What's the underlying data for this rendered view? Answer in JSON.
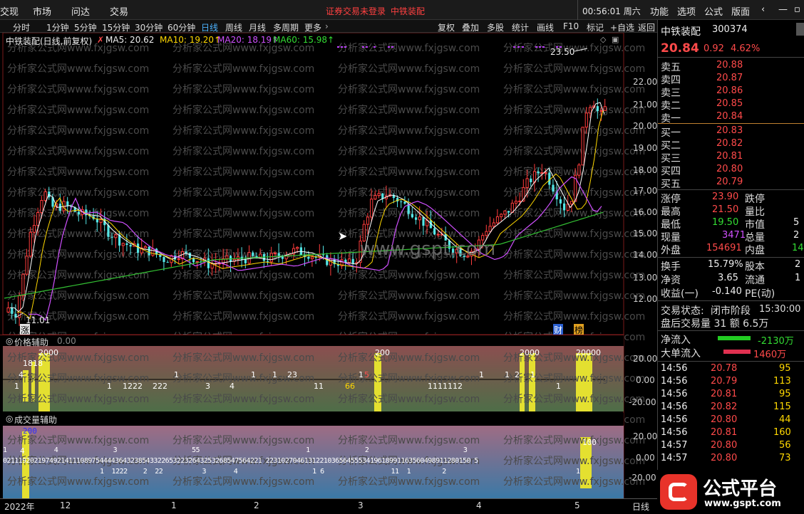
{
  "topbar": {
    "menu": [
      "交现",
      "市场",
      "问达",
      "交易"
    ],
    "warn_text": "证券交易未登录",
    "stock_short": "中铁装配",
    "time": "00:56:01 周六",
    "right_menu": [
      "功能",
      "选项",
      "公式",
      "版面"
    ]
  },
  "periods": {
    "items": [
      "分时",
      "1分钟",
      "5分钟",
      "15分钟",
      "30分钟",
      "60分钟",
      "日线",
      "周线",
      "月线",
      "多周期",
      "更多"
    ],
    "active": "日线",
    "tools": [
      "复权",
      "叠加",
      "多股",
      "统计",
      "画线",
      "F10",
      "标记",
      "+自选",
      "返回"
    ]
  },
  "legend": {
    "name": "中铁装配(日线,前复权)",
    "ma5": "MA5: 20.62",
    "ma10": "MA10: 19.20↑",
    "ma20": "MA20: 18.19↑",
    "ma60": "MA60: 15.98↑"
  },
  "main_axis": {
    "labels": [
      "22.00",
      "21.00",
      "20.00",
      "19.00",
      "18.00",
      "17.00",
      "16.00",
      "15.00",
      "14.00",
      "13.00",
      "12.00"
    ],
    "high_mark": "23.50",
    "low_mark": "11.01",
    "tag_zhang": "涨",
    "tag_cai": "财",
    "tag_bang": "榜"
  },
  "watermarks": {
    "repeat": "分析家公式网www.fxjgsw.com",
    "center": "www.gspt.com"
  },
  "price_aux": {
    "title": "价格辅助",
    "value_label": "0.00",
    "axis": [
      "20.00",
      "0.00",
      "-20.00"
    ],
    "nums_top": [
      "2000",
      "200",
      "2000",
      "20000"
    ],
    "nums_mid": [
      "1818",
      "4",
      "1",
      "1",
      "1",
      "23",
      "1",
      "5",
      "1",
      "1",
      "2",
      "1"
    ],
    "nums_low": [
      "1",
      "1",
      "1222",
      "222",
      "3",
      "4",
      "11",
      "66",
      "1111112",
      "1"
    ]
  },
  "vol_aux": {
    "title": "成交量辅助",
    "axis": [
      "20.00",
      "0.00",
      "-20.00"
    ],
    "top_num": "200",
    "right_top": "100",
    "row_a": "4",
    "row_b": "1            4              3                   55                           1              2                        3",
    "row_c": "0211192021974921411108975444436432385433226532232643253268547564221 22310270461312210365645553419618991163560498911280150 5",
    "row_d": "1  1222    2  22          3       4                   1 6                 11  1        2                                 1"
  },
  "bottom_axis": {
    "labels": [
      "2022年",
      "12",
      "1",
      "2",
      "3",
      "4",
      "5"
    ],
    "period_label": "日线"
  },
  "quote": {
    "name": "中铁装配",
    "code": "300374",
    "price": "20.84",
    "change": "0.92",
    "pct": "4.62%",
    "asks": [
      {
        "label": "卖五",
        "price": "20.88"
      },
      {
        "label": "卖四",
        "price": "20.87"
      },
      {
        "label": "卖三",
        "price": "20.86"
      },
      {
        "label": "卖二",
        "price": "20.85"
      },
      {
        "label": "卖一",
        "price": "20.84"
      }
    ],
    "bids": [
      {
        "label": "买一",
        "price": "20.83"
      },
      {
        "label": "买二",
        "price": "20.82"
      },
      {
        "label": "买三",
        "price": "20.81"
      },
      {
        "label": "买四",
        "price": "20.80"
      },
      {
        "label": "买五",
        "price": "20.79"
      }
    ],
    "stats": [
      {
        "k1": "涨停",
        "v1": "23.90",
        "k2": "跌停",
        "v2": ""
      },
      {
        "k1": "最高",
        "v1": "21.50",
        "k2": "量比",
        "v2": ""
      },
      {
        "k1": "最低",
        "v1": "19.50",
        "k2": "市值",
        "v2": "5"
      },
      {
        "k1": "现量",
        "v1": "3471",
        "k2": "总量",
        "v2": "2"
      },
      {
        "k1": "外盘",
        "v1": "154691",
        "k2": "内盘",
        "v2": "14"
      }
    ],
    "stats2": [
      {
        "k1": "换手",
        "v1": "15.79%",
        "k2": "股本",
        "v2": "2"
      },
      {
        "k1": "净资",
        "v1": "3.65",
        "k2": "流通",
        "v2": "1"
      },
      {
        "k1": "收益(一)",
        "v1": "-0.140",
        "k2": "PE(动)",
        "v2": ""
      }
    ],
    "trade_status_label": "交易状态:",
    "trade_status": "闭市阶段",
    "trade_time": "15:30:00",
    "after_hours": "盘后交易量 31 额 6.5万",
    "net_inflow_label": "净流入",
    "net_inflow": "-2130万",
    "big_inflow_label": "大单流入",
    "big_inflow": "1460万",
    "ticks": [
      {
        "t": "14:56",
        "p": "20.78",
        "v": "95"
      },
      {
        "t": "14:56",
        "p": "20.79",
        "v": "113"
      },
      {
        "t": "14:56",
        "p": "20.81",
        "v": "95"
      },
      {
        "t": "14:56",
        "p": "20.82",
        "v": "115"
      },
      {
        "t": "14:56",
        "p": "20.80",
        "v": "44"
      },
      {
        "t": "14:56",
        "p": "20.81",
        "v": "160"
      },
      {
        "t": "14:57",
        "p": "20.80",
        "v": "56"
      },
      {
        "t": "14:57",
        "p": "20.80",
        "v": "73"
      }
    ],
    "logo_text": "公式平台",
    "logo_url": "www.gspt.com"
  }
}
